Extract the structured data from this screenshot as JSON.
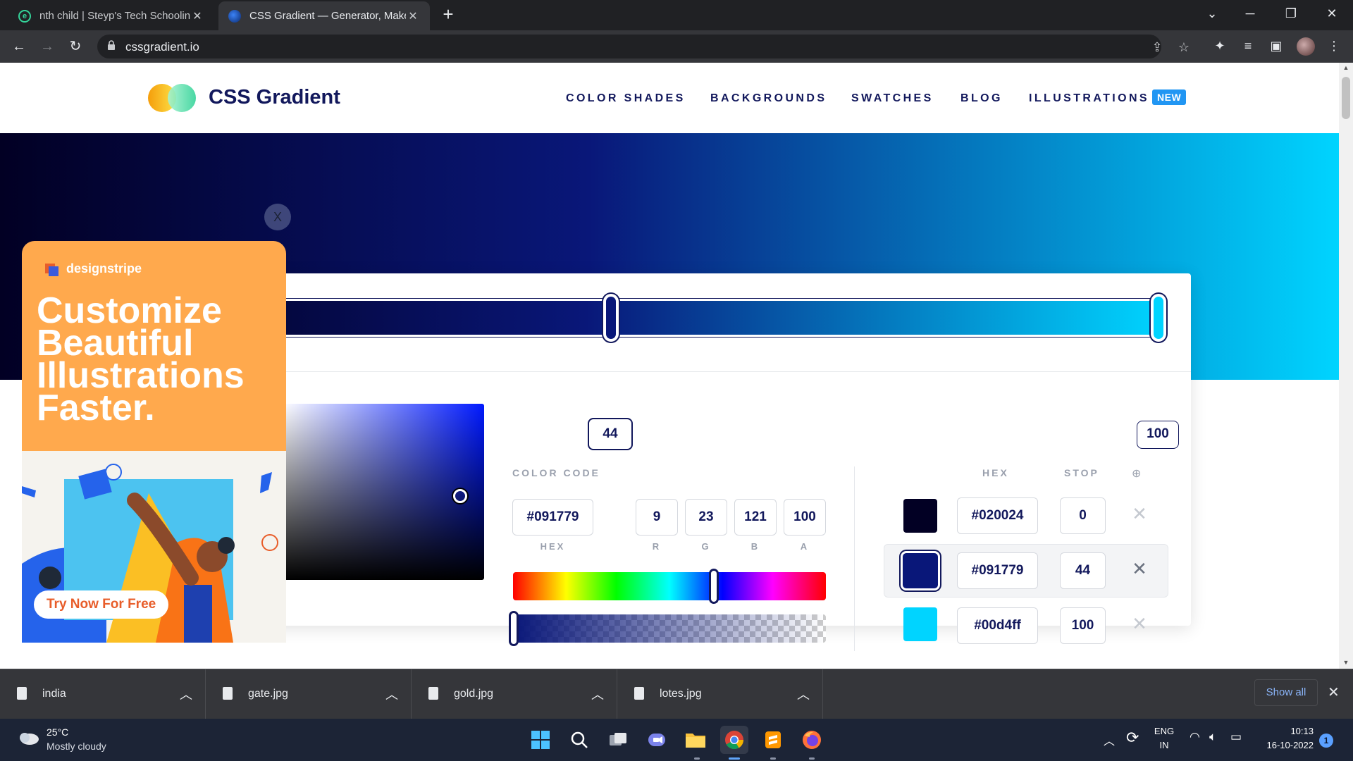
{
  "browser": {
    "tabs": [
      {
        "title": "nth child | Steyp's Tech Schooling",
        "favicon": "steyp-favicon",
        "active": false
      },
      {
        "title": "CSS Gradient — Generator, Maker",
        "favicon": "cssgradient-favicon",
        "active": true
      }
    ],
    "url": "cssgradient.io"
  },
  "site": {
    "brand": "CSS Gradient",
    "nav": [
      {
        "label": "COLOR SHADES"
      },
      {
        "label": "BACKGROUNDS"
      },
      {
        "label": "SWATCHES"
      },
      {
        "label": "BLOG"
      },
      {
        "label": "ILLUSTRATIONS"
      }
    ],
    "new_badge": "NEW"
  },
  "gradient": {
    "stop_labels": [
      "44",
      "100"
    ],
    "colors": {
      "start": "#020024",
      "middle": "#091779",
      "end": "#00d4ff"
    }
  },
  "editor": {
    "color_code_label": "COLOR CODE",
    "hex_value": "#091779",
    "hex_label": "HEX",
    "rgba": [
      {
        "label": "R",
        "value": "9"
      },
      {
        "label": "G",
        "value": "23"
      },
      {
        "label": "B",
        "value": "121"
      },
      {
        "label": "A",
        "value": "100"
      }
    ]
  },
  "stops": {
    "header_hex": "HEX",
    "header_stop": "STOP",
    "rows": [
      {
        "color": "#020024",
        "hex": "#020024",
        "stop": "0",
        "selected": false
      },
      {
        "color": "#091779",
        "hex": "#091779",
        "stop": "44",
        "selected": true
      },
      {
        "color": "#00d4ff",
        "hex": "#00d4ff",
        "stop": "100",
        "selected": false
      }
    ]
  },
  "ad": {
    "close": "X",
    "brand": "designstripe",
    "headline": "Customize Beautiful Illustrations Faster.",
    "cta": "Try Now For Free"
  },
  "downloads": {
    "items": [
      {
        "name": "india"
      },
      {
        "name": "gate.jpg"
      },
      {
        "name": "gold.jpg"
      },
      {
        "name": "lotes.jpg"
      }
    ],
    "show_all": "Show all"
  },
  "taskbar": {
    "temperature": "25°C",
    "weather": "Mostly cloudy",
    "lang_top": "ENG",
    "lang_bottom": "IN",
    "time": "10:13",
    "date": "16-10-2022",
    "notifications": "1"
  }
}
